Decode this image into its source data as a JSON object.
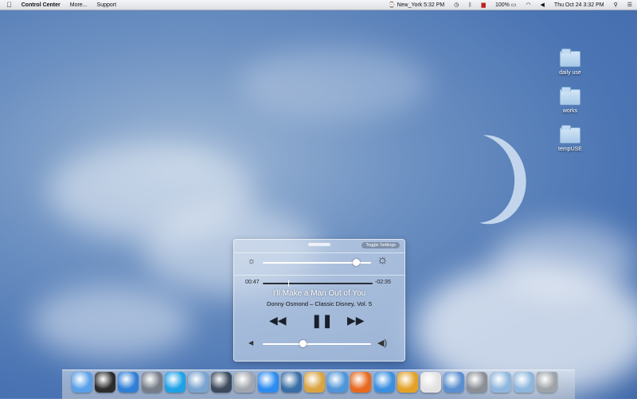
{
  "menubar": {
    "app_name": "Control Center",
    "menu_items": [
      "More...",
      "Support"
    ],
    "clock_city": "New_York 5:32 PM",
    "battery": "100%",
    "date_time": "Thu Oct 24  3:32 PM"
  },
  "desktop_icons": [
    {
      "label": "daily use"
    },
    {
      "label": "works"
    },
    {
      "label": "tempUSE"
    }
  ],
  "control_panel": {
    "toggle_settings_label": "Toggle Settings",
    "brightness_level": 0.86,
    "elapsed": "00:47",
    "remaining": "-02:35",
    "progress": 0.23,
    "song_title": "I'll Make a Man Out of You",
    "song_artist_album": "Donny Osmond – Classic Disney, Vol. 5",
    "volume_level": 0.37
  },
  "dock_icons": [
    "finder-icon",
    "dashboard-icon",
    "itunes-icon",
    "launchpad-icon",
    "skype-icon",
    "preview-icon",
    "facetime-icon",
    "image-capture-icon",
    "app-store-icon",
    "google-earth-icon",
    "fetch-icon",
    "openoffice-icon",
    "firefox-icon",
    "safari-icon",
    "ibooks-icon",
    "textedit-icon",
    "xcode-icon",
    "system-preferences-icon",
    "applications-folder-icon",
    "downloads-folder-icon",
    "trash-icon"
  ],
  "colors": {
    "accent": "#3e68a8"
  }
}
